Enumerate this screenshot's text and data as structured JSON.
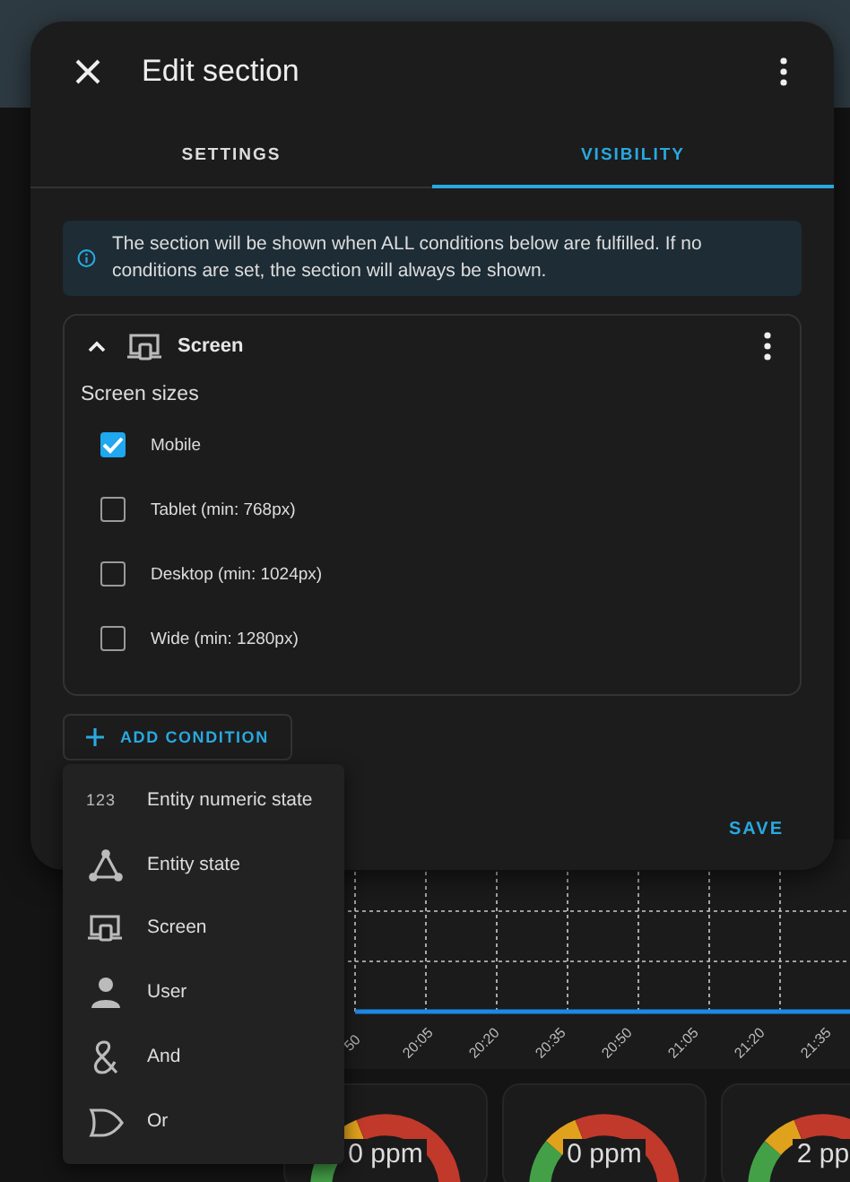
{
  "dashboard": {
    "chart": {
      "tick_labels": [
        "50",
        "20:05",
        "20:20",
        "20:35",
        "20:50",
        "21:05",
        "21:20",
        "21:35"
      ]
    },
    "gauges": [
      {
        "value": "0 ppm"
      },
      {
        "value": "0 ppm"
      },
      {
        "value": "2 pp"
      }
    ]
  },
  "dialog": {
    "title": "Edit section",
    "tabs": [
      {
        "label": "SETTINGS",
        "selected": false
      },
      {
        "label": "VISIBILITY",
        "selected": true
      }
    ],
    "info": "The section will be shown when ALL conditions below are fulfilled. If no conditions are set, the section will always be shown.",
    "conditions": [
      {
        "kind": "screen",
        "title": "Screen",
        "expanded": true,
        "group_label": "Screen sizes",
        "options": [
          {
            "label": "Mobile",
            "checked": true
          },
          {
            "label": "Tablet (min: 768px)",
            "checked": false
          },
          {
            "label": "Desktop (min: 1024px)",
            "checked": false
          },
          {
            "label": "Wide (min: 1280px)",
            "checked": false
          }
        ]
      }
    ],
    "add_button": "ADD CONDITION",
    "save_button": "SAVE"
  },
  "menu": {
    "items": [
      {
        "kind": "numeric",
        "icon_text": "123",
        "label": "Entity numeric state"
      },
      {
        "kind": "state",
        "label": "Entity state"
      },
      {
        "kind": "screen",
        "label": "Screen"
      },
      {
        "kind": "user",
        "label": "User"
      },
      {
        "kind": "and",
        "label": "And"
      },
      {
        "kind": "or",
        "label": "Or"
      }
    ]
  }
}
